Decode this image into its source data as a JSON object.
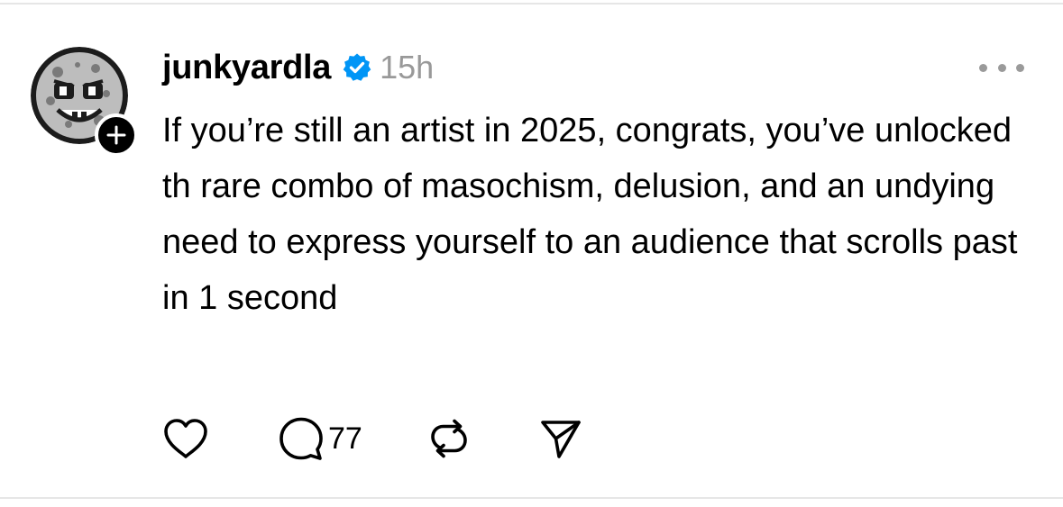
{
  "post": {
    "author": {
      "username": "junkyardla",
      "verified": true,
      "avatar_icon": "cartoon-skull-moon-avatar",
      "follow_icon": "plus-icon"
    },
    "timestamp": "15h",
    "more_icon": "more-horizontal-icon",
    "text": "If you’re still an artist in 2025, congrats, you’ve unlocked th rare combo of masochism, delusion, and an undying need to express yourself to an audience that scrolls past in 1 second",
    "actions": {
      "like_icon": "heart-icon",
      "reply_icon": "comment-icon",
      "reply_count": "77",
      "repost_icon": "repost-icon",
      "share_icon": "send-icon"
    }
  },
  "colors": {
    "text": "#000000",
    "muted": "#999999",
    "verified_badge": "#0095f6",
    "divider": "#e6e6e6"
  }
}
